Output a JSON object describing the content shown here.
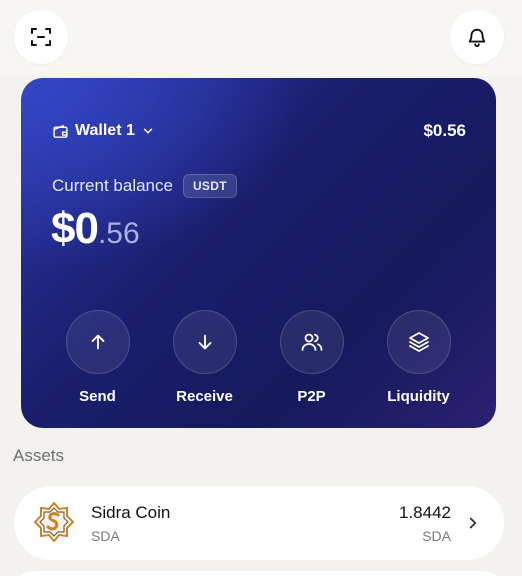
{
  "header": {
    "scan_icon": "scan-icon",
    "bell_icon": "bell-icon"
  },
  "wallet": {
    "name": "Wallet 1",
    "total": "$0.56",
    "current_balance_label": "Current balance",
    "currency_badge": "USDT",
    "balance_main": "$0",
    "balance_decimal": ".56"
  },
  "actions": [
    {
      "label": "Send",
      "icon": "arrow-up-icon"
    },
    {
      "label": "Receive",
      "icon": "arrow-down-icon"
    },
    {
      "label": "P2P",
      "icon": "users-icon"
    },
    {
      "label": "Liquidity",
      "icon": "layers-icon"
    }
  ],
  "assets": {
    "title": "Assets",
    "items": [
      {
        "name": "Sidra Coin",
        "symbol": "SDA",
        "amount": "1.8442",
        "amount_symbol": "SDA",
        "icon": "sidra-coin-logo"
      }
    ]
  },
  "colors": {
    "card_primary": "#1a1f6e",
    "card_accent": "#3546c6",
    "background": "#f4f2ee",
    "coin_gold": "#c9822a"
  }
}
